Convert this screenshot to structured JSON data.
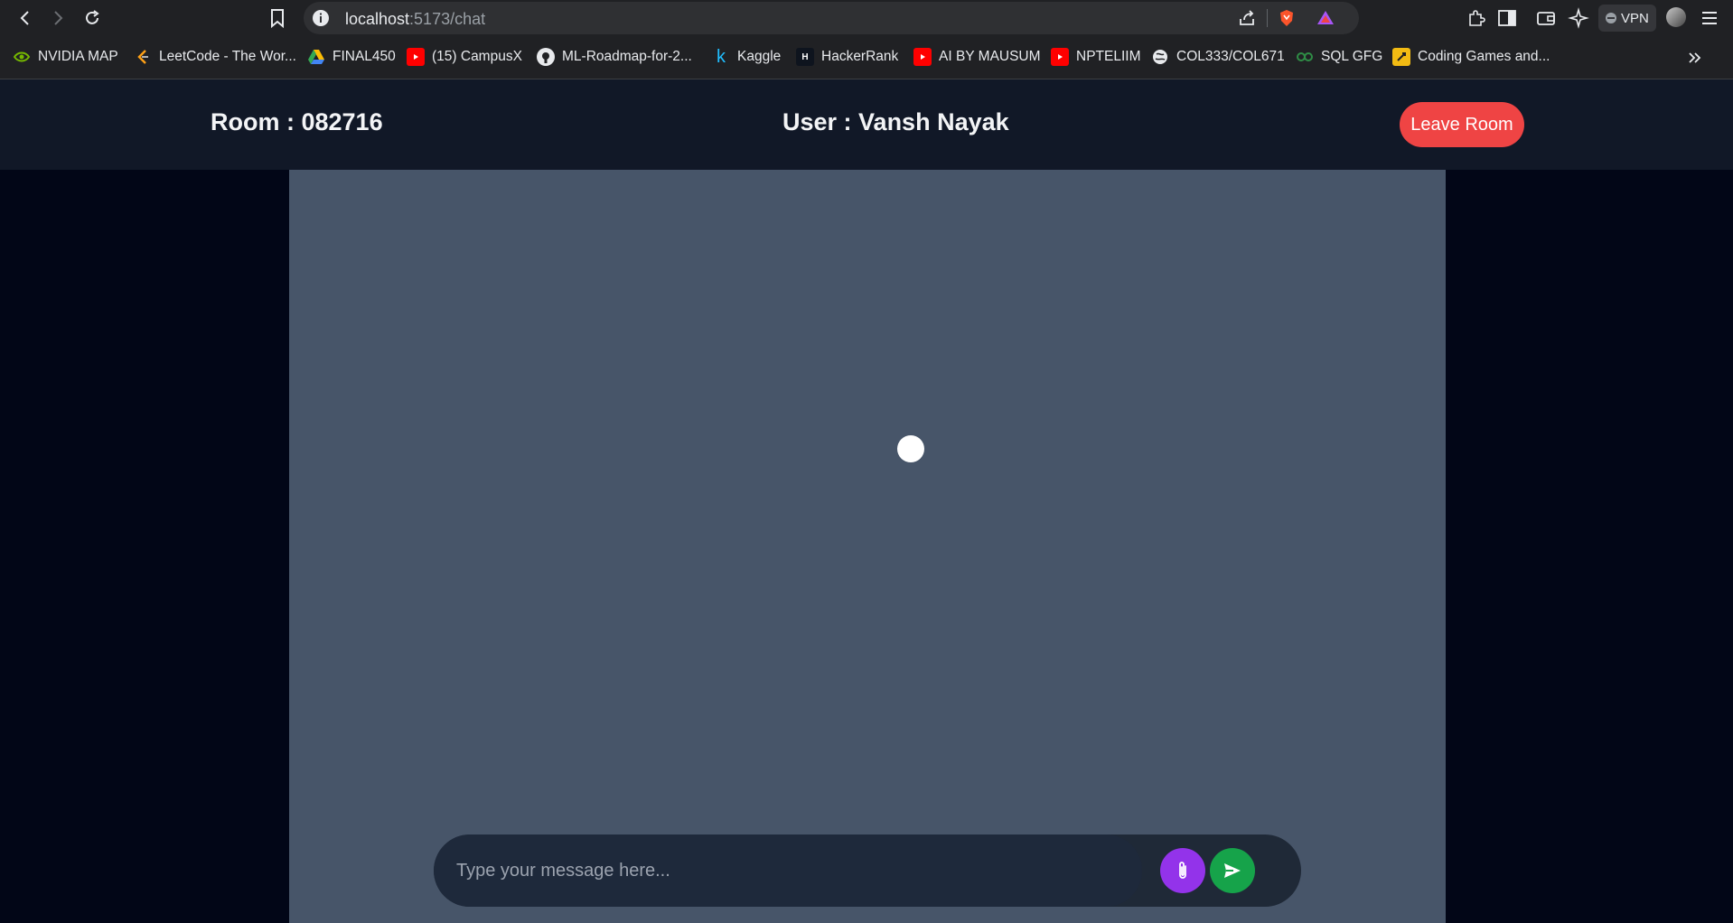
{
  "browser": {
    "url_host": "localhost",
    "url_path": ":5173/chat",
    "vpn_label": "VPN",
    "bookmarks": [
      {
        "label": "NVIDIA MAP",
        "icon": "nvidia-icon",
        "color": "#76b900"
      },
      {
        "label": "LeetCode - The Wor...",
        "icon": "leetcode-icon",
        "color": "#ffa116"
      },
      {
        "label": "FINAL450",
        "icon": "google-drive-icon",
        "color": "#34a853"
      },
      {
        "label": "(15) CampusX",
        "icon": "youtube-icon",
        "color": "#ff0000"
      },
      {
        "label": "ML-Roadmap-for-2...",
        "icon": "github-icon",
        "color": "#ffffff"
      },
      {
        "label": "Kaggle",
        "icon": "kaggle-icon",
        "color": "#20beff"
      },
      {
        "label": "HackerRank",
        "icon": "hackerrank-icon",
        "color": "#00ea64"
      },
      {
        "label": "AI BY MAUSUM",
        "icon": "youtube-icon",
        "color": "#ff0000"
      },
      {
        "label": "NPTELIIM",
        "icon": "youtube-icon",
        "color": "#ff0000"
      },
      {
        "label": "COL333/COL671",
        "icon": "globe-icon",
        "color": "#e8eaed"
      },
      {
        "label": "SQL GFG",
        "icon": "gfg-icon",
        "color": "#2f8d46"
      },
      {
        "label": "Coding Games and...",
        "icon": "codingame-icon",
        "color": "#f2bb13"
      }
    ]
  },
  "header": {
    "room_label": "Room : 082716",
    "user_label": "User : Vansh Nayak",
    "leave_label": "Leave Room"
  },
  "composer": {
    "placeholder": "Type your message here..."
  },
  "colors": {
    "header_bg": "#111827",
    "chat_bg": "#475569",
    "leave": "#ef4444",
    "attach": "#9333ea",
    "send": "#16a34a"
  }
}
